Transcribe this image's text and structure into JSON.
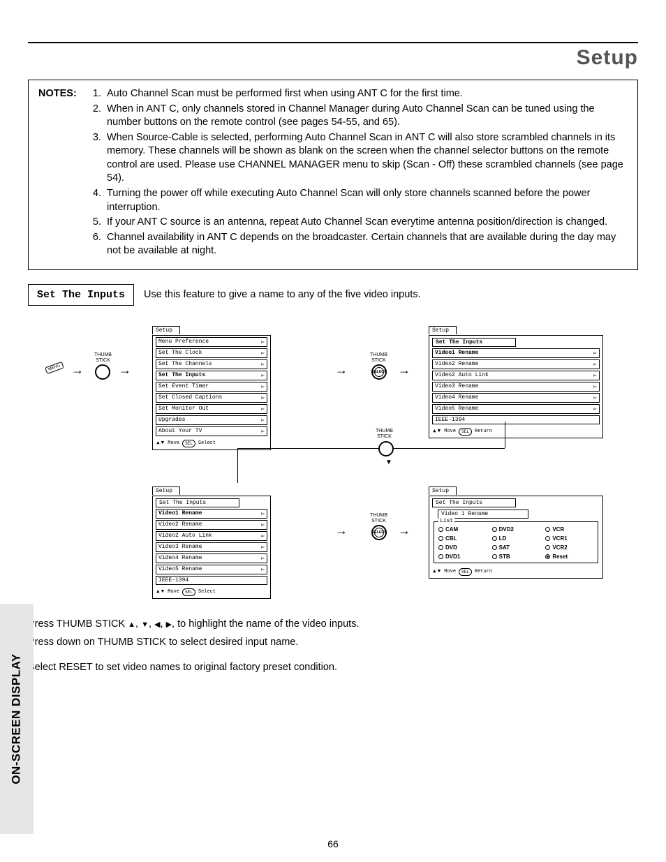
{
  "page_title": "Setup",
  "side_tab": "ON-SCREEN DISPLAY",
  "page_number": "66",
  "notes": {
    "label": "NOTES:",
    "items": [
      {
        "num": "1.",
        "text": "Auto Channel Scan must be performed first when using ANT C for the first time."
      },
      {
        "num": "2.",
        "text": "When in ANT C, only channels stored in Channel Manager during Auto Channel Scan can be tuned using the number buttons on the remote control (see pages 54-55, and 65)."
      },
      {
        "num": "3.",
        "text": "When Source-Cable is selected, performing Auto Channel Scan in ANT C will also store scrambled channels in its memory. These channels will be shown as blank on the screen when the channel selector buttons on the remote control are used.   Please use CHANNEL MANAGER menu to skip (Scan - Off) these scrambled channels (see page 54)."
      },
      {
        "num": "4.",
        "text": "Turning the power off while executing Auto Channel Scan will only store channels scanned before the power interruption."
      },
      {
        "num": "5.",
        "text": "If your ANT C source is an antenna, repeat Auto Channel Scan everytime antenna position/direction is changed."
      },
      {
        "num": "6.",
        "text": "Channel availability in ANT C depends on the broadcaster.  Certain channels that are available during the day may not be available at night."
      }
    ]
  },
  "feature": {
    "title": "Set The Inputs",
    "desc": "Use this feature to give a name to any of the five video inputs."
  },
  "menus": {
    "setup_tab": "Setup",
    "set_inputs_tab": "Set The Inputs",
    "video1_rename_tab": "Video 1 Rename",
    "list_label": "List",
    "panel1_items": [
      "Menu Preference",
      "Set The Clock",
      "Set The Channels",
      "Set The Inputs",
      "Set Event Timer",
      "Set Closed Captions",
      "Set Monitor Out",
      "Upgrades",
      "About Your TV"
    ],
    "panel1_hi_index": 3,
    "panel2_items": [
      "Video1 Rename",
      "Video2 Rename",
      "Video2 Auto Link",
      "Video3 Rename",
      "Video4 Rename",
      "Video5 Rename",
      "IEEE-1394"
    ],
    "panel2_hi_index": 0,
    "panel3_items": [
      "Video1 Rename",
      "Video2 Rename",
      "Video2 Auto Link",
      "Video3 Rename",
      "Video4 Rename",
      "Video5 Rename",
      "IEEE-1394"
    ],
    "panel3_hi_index": 0,
    "options": [
      {
        "label": "CAM",
        "sel": false
      },
      {
        "label": "DVD2",
        "sel": false
      },
      {
        "label": "VCR",
        "sel": false
      },
      {
        "label": "CBL",
        "sel": false
      },
      {
        "label": "LD",
        "sel": false
      },
      {
        "label": "VCR1",
        "sel": false
      },
      {
        "label": "DVD",
        "sel": false
      },
      {
        "label": "SAT",
        "sel": false
      },
      {
        "label": "VCR2",
        "sel": false
      },
      {
        "label": "DVD1",
        "sel": false
      },
      {
        "label": "STB",
        "sel": false
      },
      {
        "label": "Reset",
        "sel": true
      }
    ],
    "hint_move": "Move",
    "hint_select": "Select",
    "hint_return": "Return",
    "sel_pill": "SEL",
    "menu_pill": "MENU",
    "select_label": "SELECT"
  },
  "thumb_label": "THUMB\nSTICK",
  "instructions": {
    "p1a": "Press THUMB STICK ",
    "p1b": ", to highlight the name of the video inputs.",
    "p2": "Press down on THUMB STICK to select desired input name.",
    "p3": "Select RESET to set video names to original factory preset condition."
  }
}
